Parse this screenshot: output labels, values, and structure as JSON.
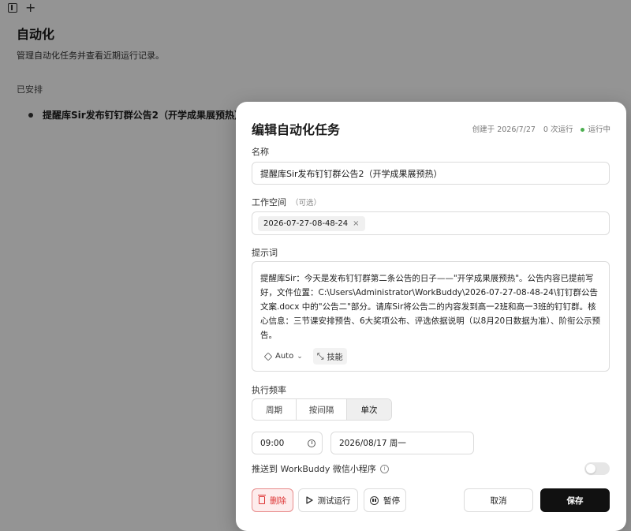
{
  "background": {
    "title": "自动化",
    "subtitle": "管理自动化任务并查看近期运行记录。",
    "section_label": "已安排",
    "task_label": "提醒库Sir发布钉钉群公告2（开学成果展预热）"
  },
  "modal": {
    "title": "编辑自动化任务",
    "meta": {
      "created": "创建于 2026/7/27",
      "runs": "0 次运行",
      "status": "运行中",
      "status_color": "#4caf50"
    },
    "name": {
      "label": "名称",
      "value": "提醒库Sir发布钉钉群公告2（开学成果展预热）"
    },
    "workspace": {
      "label": "工作空间",
      "optional": "（可选）",
      "chip": "2026-07-27-08-48-24",
      "chip_remove": "×"
    },
    "prompt": {
      "label": "提示词",
      "value": "提醒库Sir：今天是发布钉钉群第二条公告的日子——\"开学成果展预热\"。公告内容已提前写好，文件位置：C:\\Users\\Administrator\\WorkBuddy\\2026-07-27-08-48-24\\钉钉群公告文案.docx 中的\"公告二\"部分。请库Sir将公告二的内容发到高一2班和高一3班的钉钉群。核心信息：三节课安排预告、6大奖项公布、评选依据说明（以8月20日数据为准）、阶衔公示预告。",
      "model": "Auto",
      "skill": "技能"
    },
    "frequency": {
      "label": "执行频率",
      "options": [
        "周期",
        "按间隔",
        "单次"
      ],
      "selected": "单次"
    },
    "time": "09:00",
    "date": "2026/08/17 周一",
    "push": {
      "label": "推送到 WorkBuddy 微信小程序",
      "enabled": false
    },
    "buttons": {
      "delete": "删除",
      "test": "测试运行",
      "pause": "暂停",
      "cancel": "取消",
      "save": "保存"
    }
  }
}
